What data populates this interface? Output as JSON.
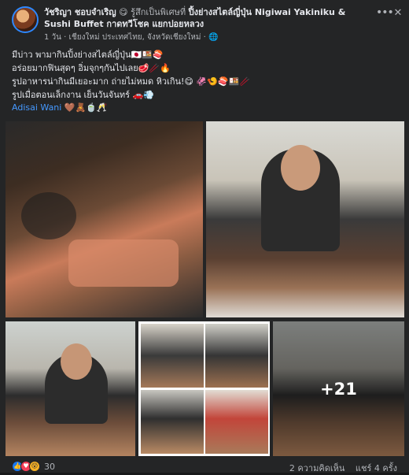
{
  "post": {
    "author": "วัชริญา ชอบจำเริญ",
    "feeling": "😋 รู้สึกเป็นพิเศษที่",
    "place": "ปิ้งย่างสไตล์ญี่ปุ่น Nigiwai Yakiniku & Sushi Buffet กาดทวีโชค แยกปอยหลวง",
    "meta": "1 วัน · เชียงใหม่ ประเทศไทย, จังหวัดเชียงใหม่ · 🌐",
    "lines": [
      "มีบ่าว พามากินปิ้งย่างสไตล์ญี่ปุ่น🇯🇵🍱🍣",
      "อร่อยมากฟินสุดๆ อิ่มจุกๆกันไปเลย🥩🥢🔥",
      "รูปอาหารน่ากินมีเยอะมาก ถ่ายไม่หมด หิวเกิน!😋 🦑🍤🍣🍱🥢"
    ],
    "footer_line": "รูปเมื่อตอนเล็กงาน เย็นวันจันทร์ 🚗💨",
    "tag": "Adisai Wani 🤎🧸🍵🥂"
  },
  "photos": {
    "more_count": "+21"
  },
  "footer": {
    "reaction_count": "30",
    "comments": "2 ความคิดเห็น",
    "shares": "แชร์ 4 ครั้ง"
  },
  "icons": {
    "more": "more-horizontal-icon",
    "close": "close-icon",
    "globe": "globe-icon",
    "like": "like-reaction-icon",
    "love": "love-reaction-icon",
    "wow": "wow-reaction-icon"
  },
  "colors": {
    "background": "#242526",
    "text": "#e4e6eb",
    "secondary": "#b0b3b8",
    "link": "#4599ff",
    "like": "#1877f2",
    "love": "#f33e58"
  }
}
